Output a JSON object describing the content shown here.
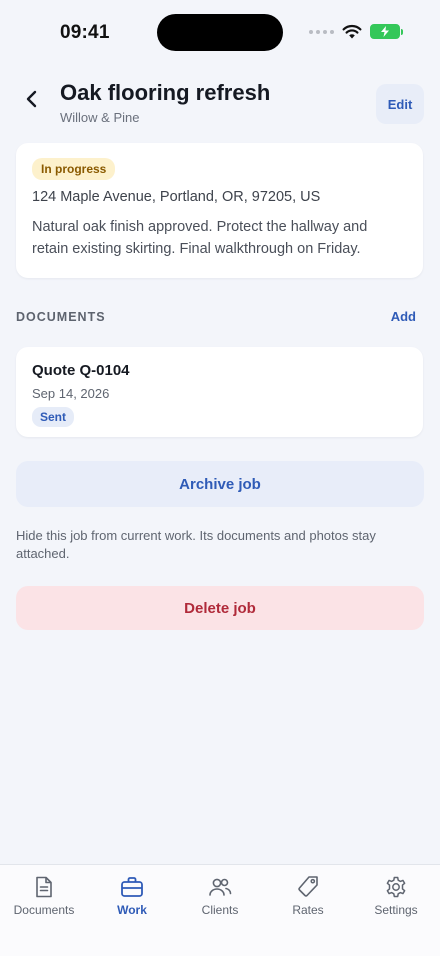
{
  "status_bar": {
    "time": "09:41"
  },
  "header": {
    "title": "Oak flooring refresh",
    "subtitle": "Willow & Pine",
    "edit_label": "Edit"
  },
  "job": {
    "status": "In progress",
    "address": "124 Maple Avenue, Portland, OR, 97205, US",
    "notes": "Natural oak finish approved. Protect the hallway and retain existing skirting. Final walkthrough on Friday."
  },
  "documents": {
    "section_label": "DOCUMENTS",
    "add_label": "Add",
    "items": [
      {
        "title": "Quote Q-0104",
        "date": "Sep 14, 2026",
        "status": "Sent"
      }
    ]
  },
  "actions": {
    "archive_label": "Archive job",
    "archive_help": "Hide this job from current work. Its documents and photos stay attached.",
    "delete_label": "Delete job"
  },
  "tabs": [
    {
      "label": "Documents",
      "icon": "document-icon"
    },
    {
      "label": "Work",
      "icon": "briefcase-icon",
      "active": true
    },
    {
      "label": "Clients",
      "icon": "people-icon"
    },
    {
      "label": "Rates",
      "icon": "tag-icon"
    },
    {
      "label": "Settings",
      "icon": "gear-icon"
    }
  ],
  "colors": {
    "accent": "#2f5bb7",
    "background": "#f3f5fa",
    "danger": "#b02a3a",
    "progress_badge": "#fdf1cc"
  }
}
